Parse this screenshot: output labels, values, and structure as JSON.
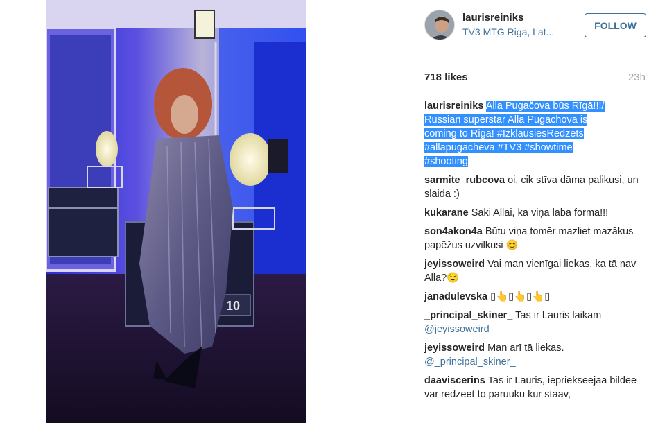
{
  "post": {
    "username": "laurisreiniks",
    "location": "TV3 MTG Riga, Lat...",
    "follow_label": "FOLLOW",
    "likes": "718 likes",
    "time": "23h"
  },
  "caption": {
    "user": "laurisreiniks",
    "text_l1": "Alla Pugačova būs Rīgā!!!/",
    "text_l2": "Russian superstar Alla Pugachova is",
    "text_l3": "coming to Riga! #IzklausiesRedzets",
    "text_l4": "#allapugacheva #TV3 #showtime",
    "text_l5": "#shooting"
  },
  "comments": [
    {
      "user": "sarmite_rubcova",
      "text": "oi. cik stīva dāma palikusi, un slaida :)"
    },
    {
      "user": "kukarane",
      "text": "Saki Allai, ka viņa labā formā!!!"
    },
    {
      "user": "son4akon4a",
      "text": "Būtu viņa tomēr mazliet mazākus papēžus uzvilkusi 😊"
    },
    {
      "user": "jeyissoweird",
      "text": "Vai man vienīgai liekas, ka tā nav Alla?😉"
    },
    {
      "user": "janadulevska",
      "text": "▯👆▯👆▯👆▯"
    },
    {
      "user": "_principal_skiner_",
      "text": "Tas ir Lauris laikam",
      "mention": "@jeyissoweird"
    },
    {
      "user": "jeyissoweird",
      "text": "Man arī tā liekas.",
      "mention": "@_principal_skiner_"
    },
    {
      "user": "daaviscerins",
      "text": "Tas ir Lauris, iepriekseejaa bildee var redzeet to paruuku kur staav,"
    }
  ],
  "photo": {
    "crate_label": "10",
    "icon": "photo-of-performer-on-stage"
  },
  "colors": {
    "link": "#3f729b",
    "highlight": "#3391ff",
    "text": "#262626"
  }
}
